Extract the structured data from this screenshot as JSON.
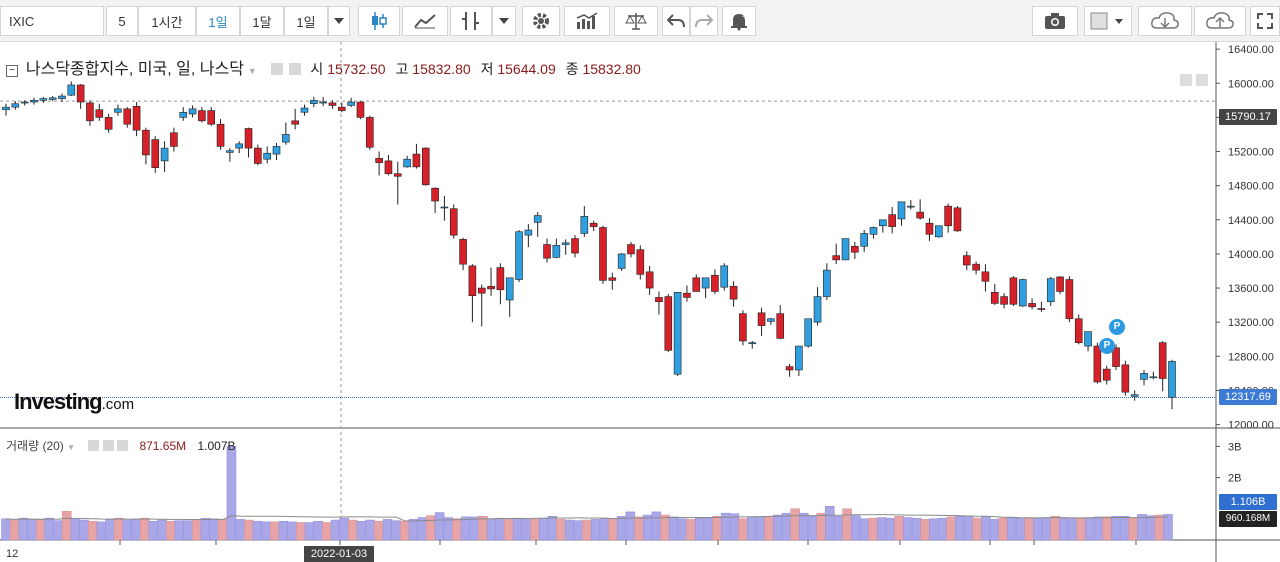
{
  "toolbar": {
    "symbol": "IXIC",
    "intervals": [
      "5",
      "1시간",
      "1일",
      "1달",
      "1일"
    ],
    "active_interval_index": 2,
    "icons": [
      "candlestick-icon",
      "line-chart-icon",
      "indicator-icon",
      "dropdown-icon",
      "settings-icon",
      "bar-volume-icon",
      "balance-icon",
      "undo-icon",
      "redo-icon",
      "alert-bell-icon",
      "camera-icon",
      "color-box-icon",
      "dropdown-icon",
      "cloud-download-icon",
      "cloud-upload-icon",
      "fullscreen-icon"
    ]
  },
  "legend": {
    "instrument": "나스닥종합지수, 미국, 일, 나스닥",
    "open_label": "시",
    "open": "15732.50",
    "high_label": "고",
    "high": "15832.80",
    "low_label": "저",
    "low": "15644.09",
    "close_label": "종",
    "close": "15832.80"
  },
  "volume_legend": {
    "name": "거래량 (20)",
    "value1": "871.65M",
    "value2": "1.007B"
  },
  "price_axis": {
    "ticks": [
      "16400.00",
      "16000.00",
      "15600.00",
      "15200.00",
      "14800.00",
      "14400.00",
      "14000.00",
      "13600.00",
      "13200.00",
      "12800.00",
      "12400.00",
      "12000.00"
    ],
    "crosshair_price": "15790.17",
    "last_price": "12317.69"
  },
  "volume_axis": {
    "ticks": [
      "3B",
      "2B"
    ],
    "volume_tag": "1.106B",
    "ma_tag": "960.168M"
  },
  "time_axis": {
    "left_label": "12",
    "crosshair_date": "2022-01-03"
  },
  "logo": {
    "main": "Investing",
    "suffix": ".com"
  },
  "colors": {
    "up": "#2f9fe0",
    "down": "#d6202a",
    "vol_up": "#a9a7e8",
    "vol_down": "#e6a4a6",
    "ma": "#8a8a8a"
  },
  "chart_data": {
    "type": "candlestick",
    "ohlc": [
      [
        15690,
        15760,
        15620,
        15720
      ],
      [
        15720,
        15790,
        15690,
        15760
      ],
      [
        15770,
        15800,
        15740,
        15780
      ],
      [
        15780,
        15830,
        15750,
        15800
      ],
      [
        15800,
        15840,
        15770,
        15820
      ],
      [
        15810,
        15850,
        15790,
        15830
      ],
      [
        15820,
        15880,
        15780,
        15850
      ],
      [
        15860,
        16020,
        15850,
        15980
      ],
      [
        15980,
        15990,
        15700,
        15780
      ],
      [
        15770,
        15800,
        15500,
        15560
      ],
      [
        15690,
        15760,
        15560,
        15600
      ],
      [
        15600,
        15640,
        15420,
        15460
      ],
      [
        15660,
        15750,
        15620,
        15700
      ],
      [
        15700,
        15720,
        15480,
        15520
      ],
      [
        15730,
        15780,
        15380,
        15450
      ],
      [
        15450,
        15480,
        15050,
        15160
      ],
      [
        15340,
        15380,
        14950,
        15010
      ],
      [
        15090,
        15320,
        14960,
        15240
      ],
      [
        15420,
        15480,
        15200,
        15260
      ],
      [
        15600,
        15720,
        15560,
        15660
      ],
      [
        15640,
        15740,
        15600,
        15700
      ],
      [
        15680,
        15720,
        15540,
        15560
      ],
      [
        15680,
        15720,
        15500,
        15520
      ],
      [
        15520,
        15580,
        15220,
        15260
      ],
      [
        15190,
        15240,
        15080,
        15210
      ],
      [
        15240,
        15320,
        15180,
        15290
      ],
      [
        15470,
        15480,
        15130,
        15240
      ],
      [
        15240,
        15280,
        15040,
        15060
      ],
      [
        15110,
        15260,
        15060,
        15180
      ],
      [
        15170,
        15300,
        15100,
        15260
      ],
      [
        15310,
        15540,
        15280,
        15400
      ],
      [
        15560,
        15700,
        15460,
        15520
      ],
      [
        15660,
        15750,
        15620,
        15710
      ],
      [
        15760,
        15840,
        15720,
        15800
      ],
      [
        15770,
        15840,
        15730,
        15780
      ],
      [
        15770,
        15800,
        15700,
        15740
      ],
      [
        15720,
        15770,
        15660,
        15680
      ],
      [
        15740,
        15830,
        15720,
        15780
      ],
      [
        15780,
        15790,
        15580,
        15600
      ],
      [
        15600,
        15620,
        15220,
        15250
      ],
      [
        15120,
        15200,
        14920,
        15070
      ],
      [
        15090,
        15160,
        14920,
        14940
      ],
      [
        14940,
        15080,
        14580,
        14910
      ],
      [
        15020,
        15150,
        15010,
        15110
      ],
      [
        15170,
        15290,
        15000,
        15020
      ],
      [
        15240,
        15250,
        14800,
        14810
      ],
      [
        14770,
        14780,
        14480,
        14620
      ],
      [
        14540,
        14680,
        14390,
        14550
      ],
      [
        14530,
        14580,
        14180,
        14220
      ],
      [
        14170,
        14190,
        13810,
        13880
      ],
      [
        13860,
        13880,
        13200,
        13510
      ],
      [
        13600,
        13640,
        13150,
        13540
      ],
      [
        13620,
        13840,
        13510,
        13590
      ],
      [
        13840,
        13890,
        13410,
        13580
      ],
      [
        13460,
        13690,
        13260,
        13720
      ],
      [
        13700,
        14280,
        13670,
        14260
      ],
      [
        14220,
        14350,
        14080,
        14280
      ],
      [
        14370,
        14490,
        14200,
        14450
      ],
      [
        14110,
        14180,
        13900,
        13950
      ],
      [
        13960,
        14180,
        13950,
        14100
      ],
      [
        14110,
        14170,
        13990,
        14130
      ],
      [
        14180,
        14220,
        13960,
        14010
      ],
      [
        14240,
        14560,
        14200,
        14440
      ],
      [
        14360,
        14390,
        14270,
        14320
      ],
      [
        14310,
        14330,
        13650,
        13690
      ],
      [
        13720,
        13780,
        13580,
        13690
      ],
      [
        13830,
        14010,
        13800,
        14000
      ],
      [
        14110,
        14140,
        13960,
        14000
      ],
      [
        14050,
        14100,
        13700,
        13760
      ],
      [
        13790,
        13860,
        13520,
        13600
      ],
      [
        13490,
        13560,
        13290,
        13440
      ],
      [
        13500,
        13530,
        12850,
        12870
      ],
      [
        12590,
        13530,
        12570,
        13550
      ],
      [
        13540,
        13630,
        13440,
        13490
      ],
      [
        13720,
        13760,
        13580,
        13560
      ],
      [
        13600,
        13710,
        13480,
        13720
      ],
      [
        13750,
        13820,
        13530,
        13560
      ],
      [
        13610,
        13890,
        13570,
        13860
      ],
      [
        13620,
        13680,
        13380,
        13470
      ],
      [
        13300,
        13340,
        12930,
        12980
      ],
      [
        12950,
        12980,
        12890,
        12960
      ],
      [
        13310,
        13370,
        13040,
        13160
      ],
      [
        13210,
        13250,
        13170,
        13240
      ],
      [
        13300,
        13400,
        13000,
        13010
      ],
      [
        12680,
        12710,
        12560,
        12640
      ],
      [
        12640,
        12800,
        12570,
        12920
      ],
      [
        12920,
        13170,
        12900,
        13240
      ],
      [
        13200,
        13610,
        13160,
        13500
      ],
      [
        13500,
        13890,
        13460,
        13810
      ],
      [
        13980,
        14120,
        13880,
        13930
      ],
      [
        13930,
        14150,
        13930,
        14180
      ],
      [
        14090,
        14140,
        13940,
        14020
      ],
      [
        14090,
        14280,
        14020,
        14240
      ],
      [
        14230,
        14320,
        14180,
        14310
      ],
      [
        14330,
        14380,
        14250,
        14400
      ],
      [
        14460,
        14550,
        14240,
        14320
      ],
      [
        14410,
        14520,
        14330,
        14610
      ],
      [
        14550,
        14630,
        14520,
        14560
      ],
      [
        14490,
        14640,
        14400,
        14420
      ],
      [
        14360,
        14420,
        14150,
        14230
      ],
      [
        14200,
        14320,
        14190,
        14330
      ],
      [
        14560,
        14590,
        14250,
        14330
      ],
      [
        14540,
        14560,
        14260,
        14270
      ],
      [
        13980,
        14030,
        13810,
        13870
      ],
      [
        13880,
        13910,
        13760,
        13810
      ],
      [
        13790,
        13880,
        13560,
        13680
      ],
      [
        13550,
        13650,
        13400,
        13420
      ],
      [
        13500,
        13540,
        13360,
        13410
      ],
      [
        13720,
        13740,
        13390,
        13410
      ],
      [
        13390,
        13710,
        13380,
        13700
      ],
      [
        13420,
        13480,
        13350,
        13380
      ],
      [
        13360,
        13440,
        13320,
        13350
      ],
      [
        13440,
        13730,
        13390,
        13710
      ],
      [
        13730,
        13740,
        13530,
        13560
      ],
      [
        13700,
        13740,
        13200,
        13240
      ],
      [
        13240,
        13290,
        12940,
        12960
      ],
      [
        12920,
        13090,
        12860,
        13090
      ],
      [
        12920,
        12960,
        12480,
        12500
      ],
      [
        12650,
        12690,
        12470,
        12520
      ],
      [
        12900,
        12940,
        12640,
        12680
      ],
      [
        12700,
        12750,
        12340,
        12380
      ],
      [
        12330,
        12400,
        12280,
        12350
      ],
      [
        12530,
        12640,
        12460,
        12600
      ],
      [
        12560,
        12620,
        12530,
        12560
      ],
      [
        12960,
        12980,
        12390,
        12540
      ],
      [
        12320,
        12760,
        12180,
        12740
      ]
    ],
    "volume": [
      680,
      640,
      700,
      660,
      650,
      700,
      620,
      920,
      660,
      640,
      600,
      580,
      660,
      700,
      640,
      660,
      700,
      600,
      640,
      600,
      620,
      620,
      640,
      700,
      680,
      660,
      3000,
      660,
      640,
      600,
      580,
      580,
      600,
      580,
      560,
      560,
      600,
      560,
      640,
      700,
      640,
      600,
      640,
      600,
      660,
      620,
      600,
      660,
      720,
      780,
      880,
      720,
      680,
      740,
      740,
      760,
      680,
      700,
      680,
      700,
      660,
      660,
      700,
      760,
      660,
      640,
      620,
      640,
      660,
      700,
      660,
      760,
      900,
      740,
      800,
      900,
      800,
      740,
      680,
      660,
      700,
      700,
      760,
      860,
      840,
      680,
      720,
      740,
      760,
      800,
      860,
      1000,
      860,
      760,
      860,
      1080,
      760,
      1000,
      780,
      680,
      700,
      720,
      700,
      760,
      720,
      700,
      660,
      680,
      700,
      740,
      760,
      740,
      700,
      740,
      660,
      700,
      720,
      700,
      720,
      680,
      720,
      760,
      720,
      680,
      700,
      720,
      740,
      740,
      760,
      760,
      700,
      820,
      780,
      800,
      820
    ],
    "ylim": [
      11960,
      16460
    ]
  }
}
